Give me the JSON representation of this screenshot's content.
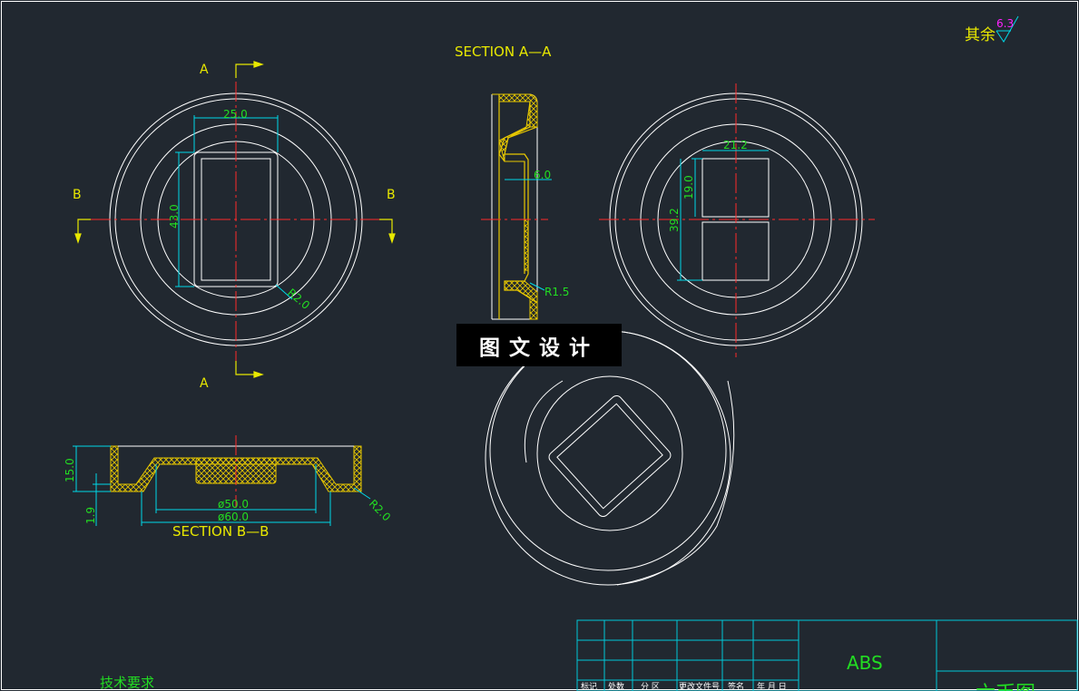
{
  "drawing": {
    "section_aa_title": "SECTION A—A",
    "section_bb_title": "SECTION B—B",
    "cut_label_a": "A",
    "cut_label_b": "B",
    "roughness_label": "其余",
    "roughness_value": "6.3",
    "material": "ABS",
    "tech_requirements": "技术要求",
    "watermark": "图文设计",
    "colors": {
      "background": "#212830",
      "outline": "#ffffff",
      "centerline": "#ff2a2a",
      "dimension": "#22dd22",
      "dim_line": "#00d8e8",
      "annotation": "#e8e800",
      "section_fill": "#e8c800",
      "roughness": "#ff22ff",
      "titleblock": "#00c8d8"
    }
  },
  "dimensions": {
    "top_width": "25.0",
    "top_height": "43.0",
    "top_fillet": "R2.0",
    "aa_thickness": "6.0",
    "aa_fillet": "R1.5",
    "right_width": "21.2",
    "right_height_small": "19.0",
    "right_height_total": "39.2",
    "bb_height": "15.0",
    "bb_step": "1.9",
    "bb_inner_dia": "ø50.0",
    "bb_outer_dia": "ø60.0",
    "bb_fillet": "R2.0"
  },
  "title_block": {
    "headers": [
      "标记",
      "处数",
      "分 区",
      "更改文件号",
      "签名",
      "年 月 日"
    ],
    "drawing_name_partial": "六币图"
  }
}
